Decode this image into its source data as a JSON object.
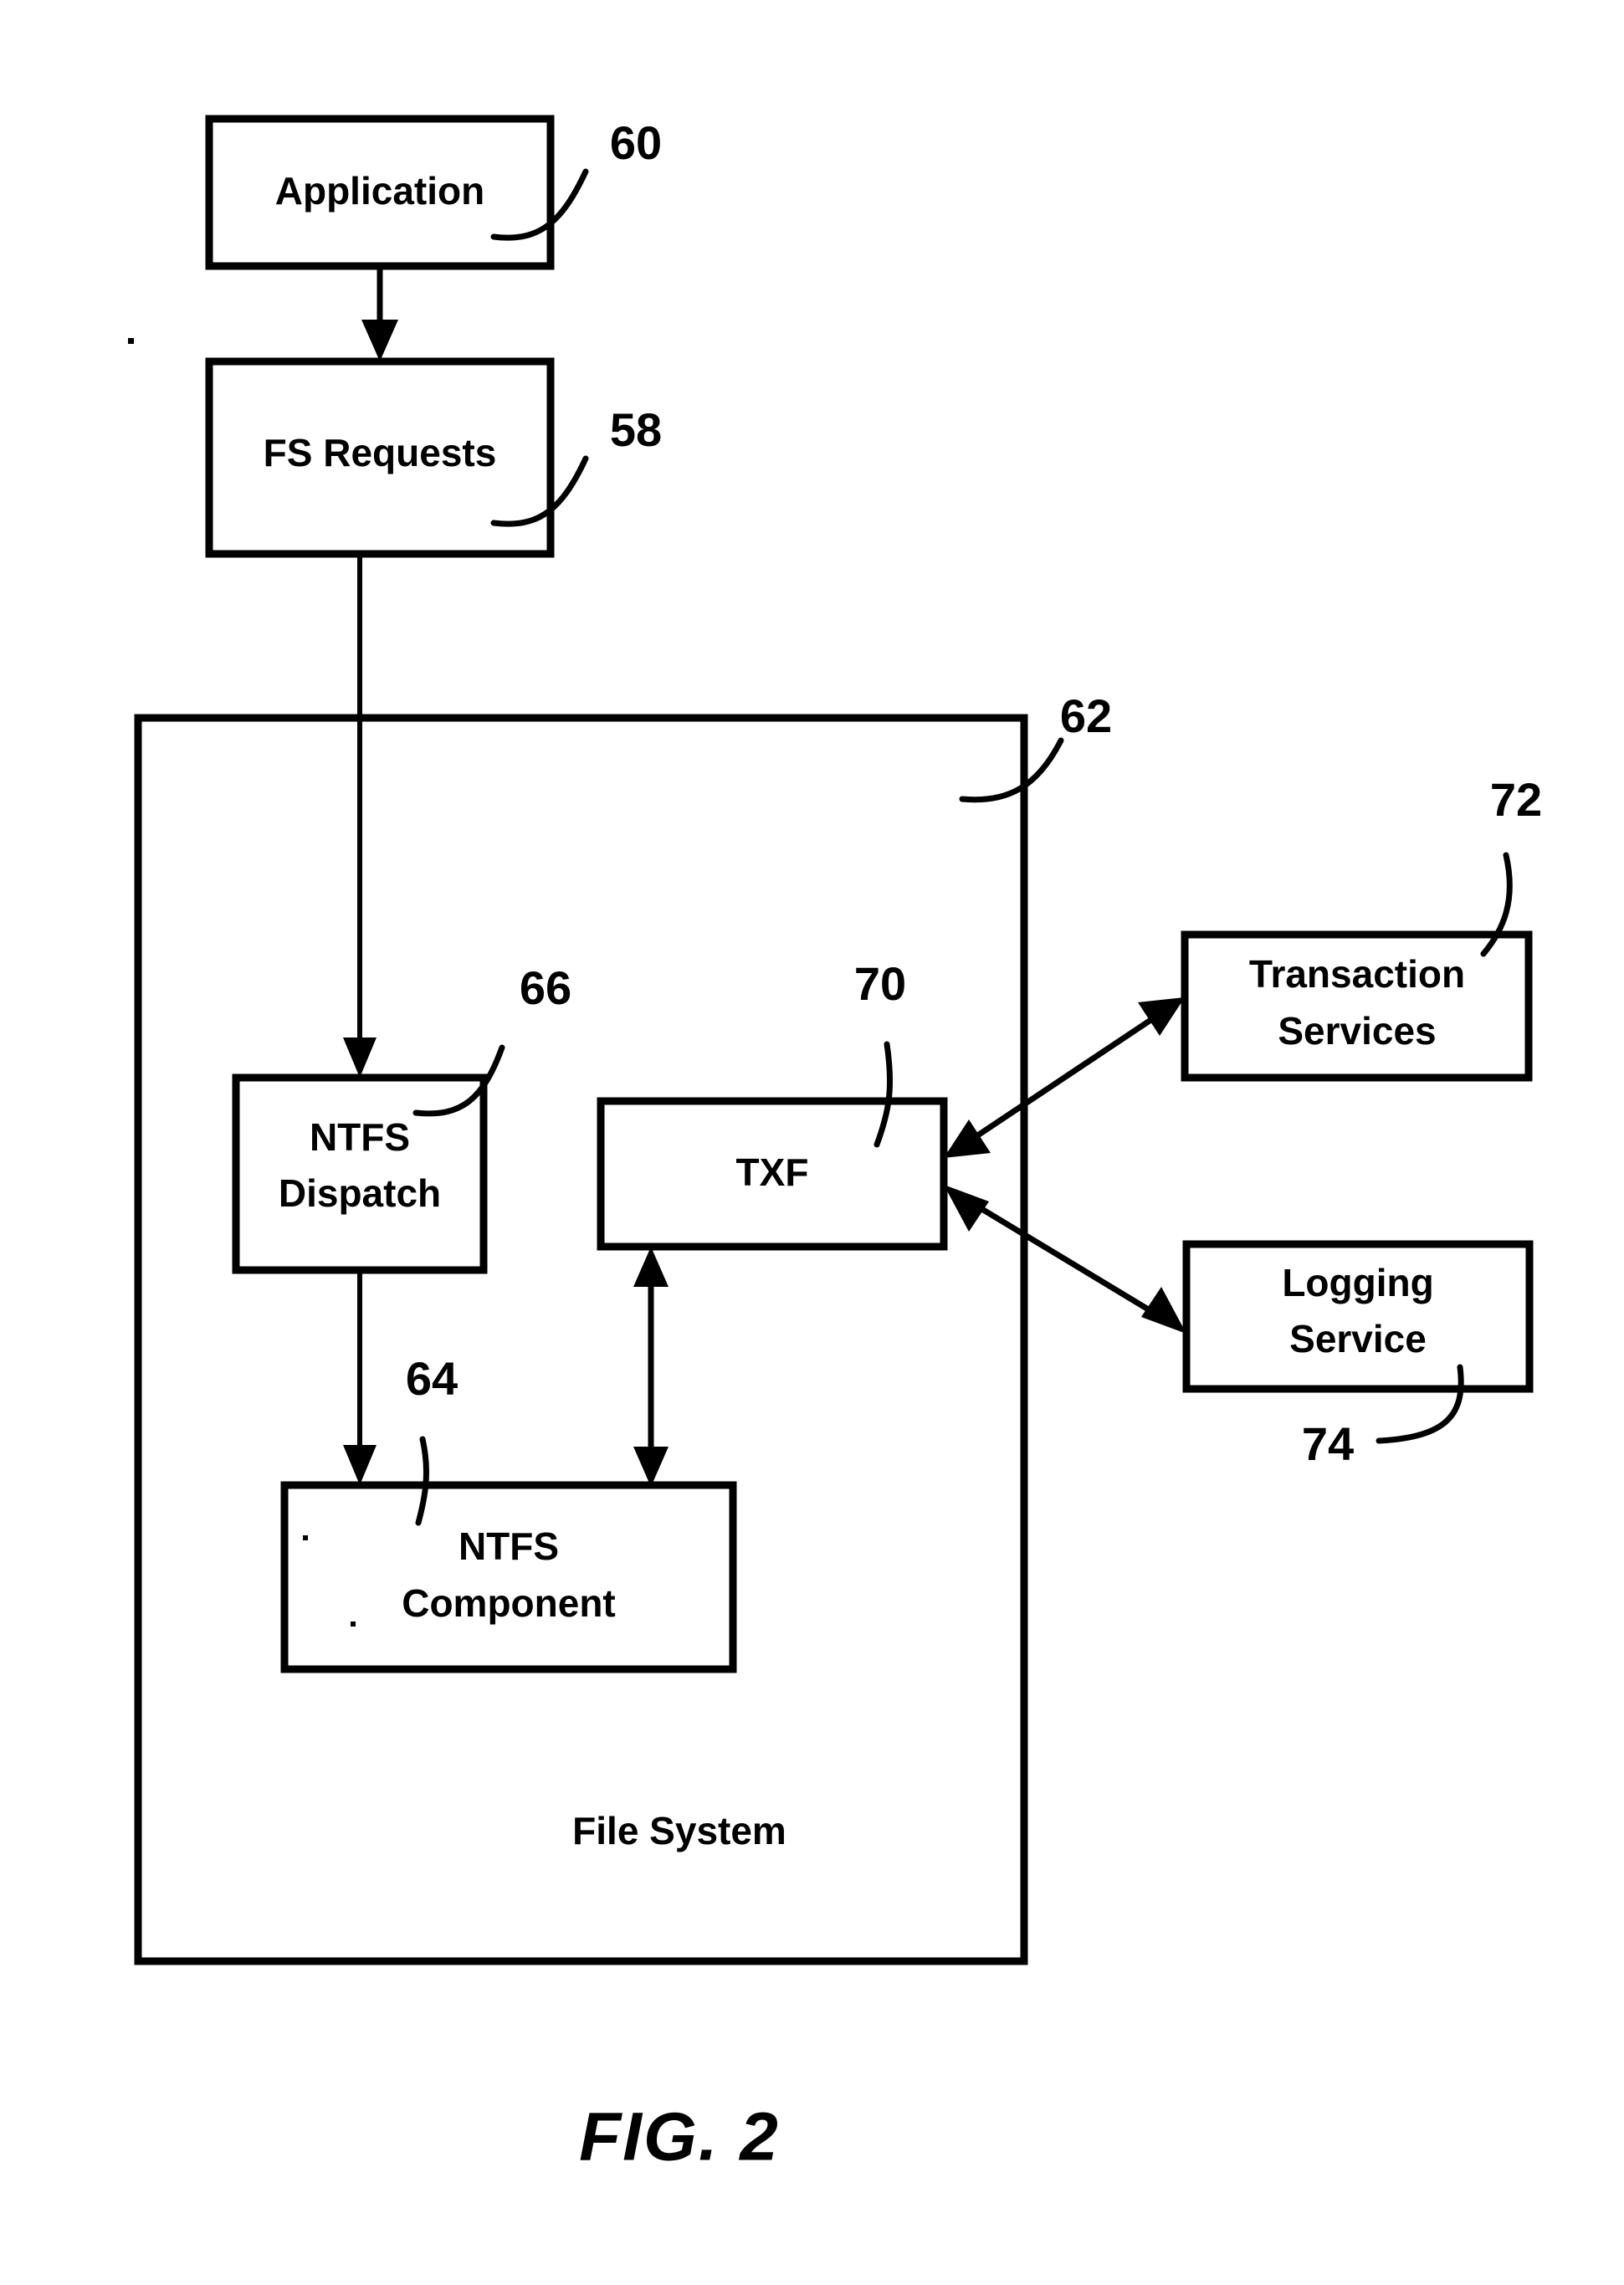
{
  "figure": {
    "caption": "FIG. 2",
    "container": {
      "label": "File System",
      "ref": "62"
    },
    "boxes": [
      {
        "id": "application",
        "label_line1": "Application",
        "label_line2": "",
        "ref": "60"
      },
      {
        "id": "fs-requests",
        "label_line1": "FS Requests",
        "label_line2": "",
        "ref": "58"
      },
      {
        "id": "ntfs-dispatch",
        "label_line1": "NTFS",
        "label_line2": "Dispatch",
        "ref": "66"
      },
      {
        "id": "txf",
        "label_line1": "TXF",
        "label_line2": "",
        "ref": "70"
      },
      {
        "id": "ntfs-component",
        "label_line1": "NTFS",
        "label_line2": "Component",
        "ref": "64"
      },
      {
        "id": "transaction-services",
        "label_line1": "Transaction",
        "label_line2": "Services",
        "ref": "72"
      },
      {
        "id": "logging-service",
        "label_line1": "Logging",
        "label_line2": "Service",
        "ref": "74"
      }
    ],
    "connections": [
      {
        "from": "application",
        "to": "fs-requests",
        "arrows": "single"
      },
      {
        "from": "fs-requests",
        "to": "ntfs-dispatch",
        "arrows": "single"
      },
      {
        "from": "ntfs-dispatch",
        "to": "ntfs-component",
        "arrows": "single"
      },
      {
        "from": "txf",
        "to": "ntfs-component",
        "arrows": "double"
      },
      {
        "from": "txf",
        "to": "transaction-services",
        "arrows": "double"
      },
      {
        "from": "txf",
        "to": "logging-service",
        "arrows": "double"
      }
    ],
    "colors": {
      "stroke": "#000000",
      "fill": "#ffffff",
      "background": "#ffffff"
    }
  }
}
